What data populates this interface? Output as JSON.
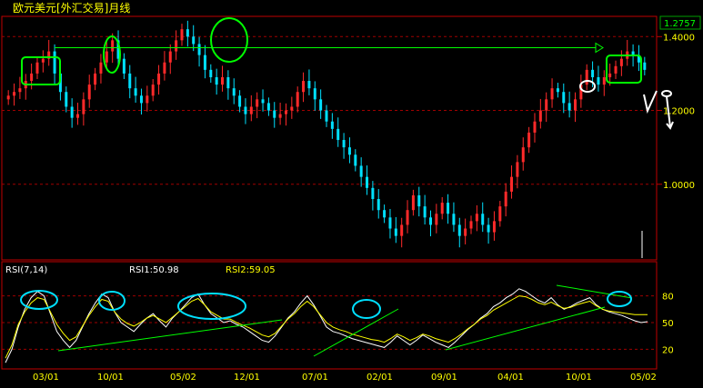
{
  "chart_title": "欧元美元[外汇交易]月线",
  "current_price_label": "1.2757",
  "colors": {
    "background": "#000000",
    "frame": "#c00000",
    "grid": "#a00000",
    "up_candle": "#ff2a2a",
    "down_candle": "#00e0ff",
    "axis_text": "#ffff00",
    "title_text": "#ffff00",
    "price_label_text": "#00ff00",
    "annotation_green": "#00ff00",
    "annotation_white": "#ffffff",
    "rsi_white": "#ffffff",
    "rsi_yellow": "#ffff00",
    "trend_green": "#00ff00",
    "ellipse_cyan": "#00e0ff"
  },
  "chart_data": [
    {
      "type": "candlestick",
      "title": "欧元美元[外汇交易]月线",
      "ylim": [
        0.8,
        1.45
      ],
      "y_ticks": [
        "1.4000",
        "1.2000",
        "1.0000"
      ],
      "y_tick_values": [
        1.4,
        1.2,
        1.0
      ],
      "grid": true,
      "horizontal_guide": {
        "value": 1.37,
        "arrow": "right"
      },
      "circled_highs": [
        "green box near 97/07",
        "green ellipse near 98/10",
        "green ellipse near 99/12",
        "white ellipse near 04/12",
        "green box near 05/02"
      ],
      "closes": [
        1.24,
        1.25,
        1.26,
        1.28,
        1.3,
        1.33,
        1.34,
        1.36,
        1.3,
        1.25,
        1.21,
        1.18,
        1.19,
        1.23,
        1.27,
        1.3,
        1.33,
        1.36,
        1.39,
        1.34,
        1.3,
        1.26,
        1.24,
        1.22,
        1.24,
        1.27,
        1.3,
        1.33,
        1.36,
        1.39,
        1.42,
        1.4,
        1.38,
        1.35,
        1.31,
        1.29,
        1.27,
        1.29,
        1.26,
        1.24,
        1.21,
        1.19,
        1.21,
        1.23,
        1.22,
        1.2,
        1.18,
        1.19,
        1.2,
        1.21,
        1.25,
        1.28,
        1.26,
        1.23,
        1.2,
        1.17,
        1.15,
        1.12,
        1.1,
        1.08,
        1.05,
        1.02,
        0.99,
        0.96,
        0.93,
        0.91,
        0.88,
        0.86,
        0.89,
        0.93,
        0.97,
        0.94,
        0.91,
        0.89,
        0.92,
        0.95,
        0.92,
        0.89,
        0.86,
        0.88,
        0.9,
        0.92,
        0.89,
        0.87,
        0.9,
        0.94,
        0.98,
        1.02,
        1.06,
        1.1,
        1.14,
        1.17,
        1.2,
        1.23,
        1.26,
        1.25,
        1.22,
        1.2,
        1.23,
        1.27,
        1.31,
        1.29,
        1.27,
        1.29,
        1.3,
        1.32,
        1.34,
        1.36,
        1.35,
        1.33,
        1.31
      ]
    },
    {
      "type": "line",
      "title": "RSI(7,14)",
      "ylim": [
        0,
        100
      ],
      "y_ticks": [
        "80",
        "50",
        "20"
      ],
      "y_tick_values": [
        80,
        50,
        20
      ],
      "x_tick_labels": [
        "03/01",
        "10/01",
        "05/02",
        "12/01",
        "07/01",
        "02/01",
        "09/01",
        "04/01",
        "10/01",
        "05/02"
      ],
      "grid": true,
      "series": [
        {
          "name": "RSI1:50.98",
          "values": [
            5,
            20,
            45,
            65,
            78,
            85,
            80,
            60,
            40,
            30,
            22,
            30,
            45,
            60,
            72,
            82,
            78,
            62,
            50,
            45,
            40,
            48,
            55,
            60,
            52,
            45,
            55,
            62,
            70,
            78,
            82,
            70,
            60,
            55,
            50,
            52,
            48,
            45,
            40,
            35,
            30,
            28,
            35,
            45,
            55,
            62,
            72,
            80,
            70,
            58,
            45,
            40,
            38,
            35,
            32,
            30,
            28,
            26,
            24,
            22,
            28,
            35,
            30,
            25,
            30,
            36,
            32,
            28,
            25,
            22,
            28,
            35,
            42,
            48,
            55,
            60,
            68,
            72,
            78,
            82,
            88,
            85,
            80,
            75,
            72,
            78,
            70,
            65,
            68,
            72,
            75,
            78,
            70,
            65,
            62,
            60,
            58,
            55,
            52,
            50,
            51
          ]
        },
        {
          "name": "RSI2:59.05",
          "values": [
            10,
            25,
            48,
            62,
            72,
            78,
            76,
            62,
            48,
            38,
            30,
            34,
            46,
            58,
            68,
            76,
            74,
            62,
            54,
            49,
            46,
            50,
            55,
            58,
            54,
            50,
            56,
            62,
            68,
            74,
            77,
            70,
            62,
            58,
            54,
            54,
            50,
            47,
            44,
            40,
            36,
            34,
            38,
            46,
            54,
            60,
            68,
            74,
            68,
            59,
            50,
            45,
            42,
            40,
            37,
            35,
            33,
            31,
            30,
            28,
            32,
            37,
            34,
            30,
            33,
            37,
            35,
            32,
            30,
            28,
            32,
            37,
            43,
            48,
            54,
            58,
            64,
            68,
            72,
            76,
            80,
            79,
            76,
            72,
            70,
            73,
            69,
            66,
            67,
            70,
            72,
            74,
            69,
            65,
            63,
            62,
            61,
            60,
            59,
            59,
            59
          ]
        }
      ]
    }
  ],
  "rsi_label": "RSI(7,14)",
  "rsi1_label": "RSI1:50.98",
  "rsi2_label": "RSI2:59.05"
}
